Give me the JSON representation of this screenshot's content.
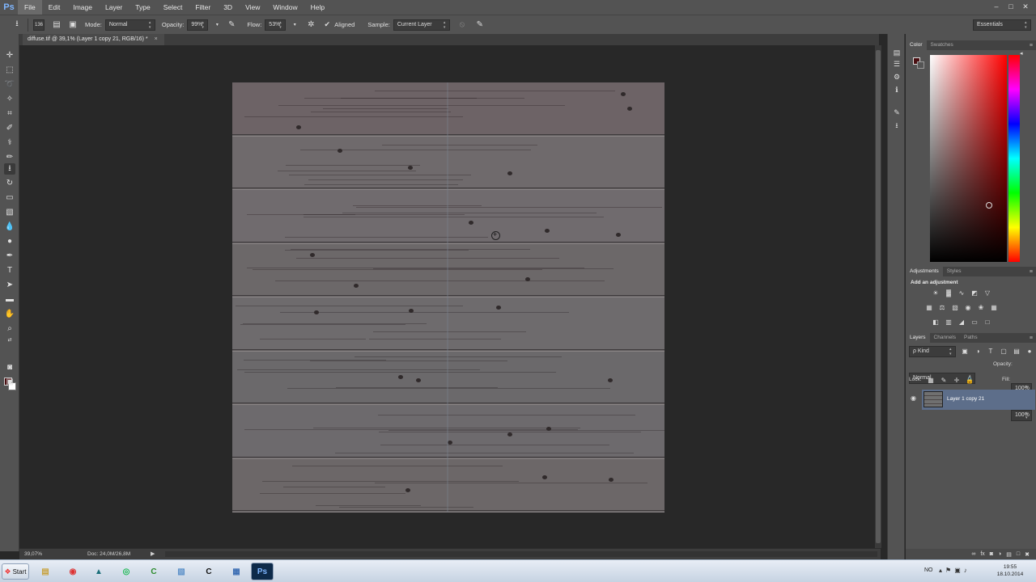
{
  "app": {
    "logo": "Ps"
  },
  "menu": [
    "File",
    "Edit",
    "Image",
    "Layer",
    "Type",
    "Select",
    "Filter",
    "3D",
    "View",
    "Window",
    "Help"
  ],
  "window_controls": [
    "–",
    "□",
    "✕"
  ],
  "options": {
    "brush_size": "136",
    "mode_label": "Mode:",
    "mode_value": "Normal",
    "opacity_label": "Opacity:",
    "opacity_value": "99%",
    "flow_label": "Flow:",
    "flow_value": "53%",
    "aligned_label": "Aligned",
    "aligned_checked": true,
    "sample_label": "Sample:",
    "sample_value": "Current Layer",
    "workspace": "Essentials"
  },
  "document": {
    "tab_title": "diffuse.tif @ 39,1% (Layer 1 copy 21, RGB/16) *",
    "close": "×"
  },
  "status": {
    "zoom": "39,07%",
    "doc_info": "Doc: 24,0M/26,8M",
    "arrow": "▶"
  },
  "panels": {
    "color_tabs": [
      "Color",
      "Swatches"
    ],
    "foreground_color": "#4a0f12",
    "adjust_tabs": [
      "Adjustments",
      "Styles"
    ],
    "adjust_title": "Add an adjustment",
    "layers_tabs": [
      "Layers",
      "Channels",
      "Paths"
    ],
    "kind_filter": "ρ Kind",
    "blend_mode": "Normal",
    "opacity_label": "Opacity:",
    "opacity_value": "100%",
    "lock_label": "Lock:",
    "fill_label": "Fill:",
    "fill_value": "100%",
    "layer_name": "Layer 1 copy 21"
  },
  "taskbar": {
    "start_label": "Start",
    "lang": "NO",
    "time": "19:55",
    "date": "18.10.2014"
  },
  "colors": {
    "ui_bg": "#535353",
    "canvas_bg": "#282828",
    "layer_selected": "#5d6e8a",
    "ps_blue": "#7fb6ff"
  }
}
